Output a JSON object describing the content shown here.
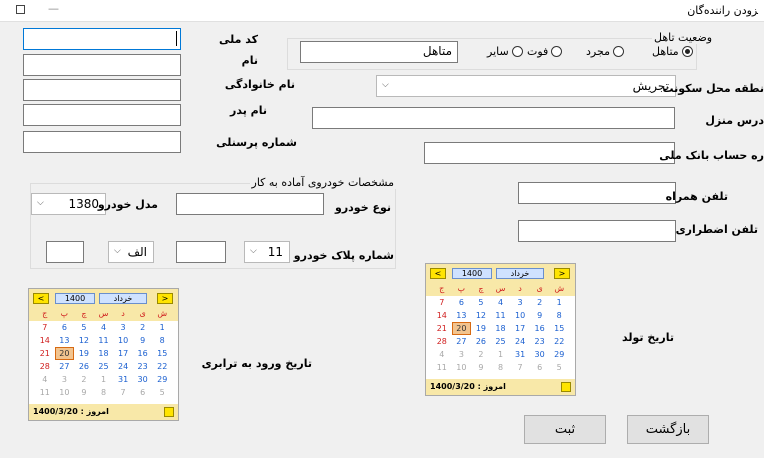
{
  "window": {
    "title": "ﺰودن راننده‌گان"
  },
  "right_form": {
    "marital": {
      "title": "وضعیت تاهل",
      "options": [
        "متاهل",
        "مجرد",
        "فوت",
        "سایر"
      ],
      "value": "متاهل"
    },
    "marital_text": "متاهل",
    "residence_region": {
      "label": "نطقه محل سکونت",
      "value": "تجریش"
    },
    "home_address": {
      "label": "درس منزل",
      "value": ""
    },
    "bank_account": {
      "label": "ره حساب بانک ملی",
      "value": ""
    },
    "mobile": {
      "label": "تلفن همراه",
      "value": ""
    },
    "emergency_phone": {
      "label": "تلفن اضطراری",
      "value": ""
    },
    "birth_date": {
      "label": "تاریخ تولد"
    }
  },
  "left_form": {
    "code_meli": {
      "label": "کد ملی",
      "value": ""
    },
    "first_name": {
      "label": "نام",
      "value": ""
    },
    "last_name": {
      "label": "نام خانوادگی",
      "value": ""
    },
    "father_name": {
      "label": "نام پدر",
      "value": ""
    },
    "personnel_no": {
      "label": "شماره پرسنلی",
      "value": ""
    }
  },
  "vehicle": {
    "title": "مشخصات خودروی آماده به کار",
    "car_type": {
      "label": "نوع خودرو",
      "value": ""
    },
    "car_model": {
      "label": "مدل خودرو",
      "value": "1380"
    },
    "plate": {
      "label": "شماره پلاک خودرو",
      "part1": "11",
      "letter": "الف",
      "part2": "",
      "part3": ""
    }
  },
  "entry_date": {
    "label": "تاریخ ورود به ترابری"
  },
  "calendar": {
    "month": "خرداد",
    "year": "1400",
    "prev": "<",
    "next": ">",
    "weekdays": [
      "ش",
      "ی",
      "د",
      "س",
      "چ",
      "پ",
      "ج"
    ],
    "days": [
      {
        "d": "1",
        "t": "n"
      },
      {
        "d": "2",
        "t": "n"
      },
      {
        "d": "3",
        "t": "n"
      },
      {
        "d": "4",
        "t": "n"
      },
      {
        "d": "5",
        "t": "n"
      },
      {
        "d": "6",
        "t": "n"
      },
      {
        "d": "7",
        "t": "f"
      },
      {
        "d": "8",
        "t": "n"
      },
      {
        "d": "9",
        "t": "n"
      },
      {
        "d": "10",
        "t": "n"
      },
      {
        "d": "11",
        "t": "n"
      },
      {
        "d": "12",
        "t": "n"
      },
      {
        "d": "13",
        "t": "n"
      },
      {
        "d": "14",
        "t": "f"
      },
      {
        "d": "15",
        "t": "n"
      },
      {
        "d": "16",
        "t": "n"
      },
      {
        "d": "17",
        "t": "n"
      },
      {
        "d": "18",
        "t": "n"
      },
      {
        "d": "19",
        "t": "n"
      },
      {
        "d": "20",
        "t": "s"
      },
      {
        "d": "21",
        "t": "f"
      },
      {
        "d": "22",
        "t": "n"
      },
      {
        "d": "23",
        "t": "n"
      },
      {
        "d": "24",
        "t": "n"
      },
      {
        "d": "25",
        "t": "n"
      },
      {
        "d": "26",
        "t": "n"
      },
      {
        "d": "27",
        "t": "n"
      },
      {
        "d": "28",
        "t": "f"
      },
      {
        "d": "29",
        "t": "n"
      },
      {
        "d": "30",
        "t": "n"
      },
      {
        "d": "31",
        "t": "n"
      },
      {
        "d": "1",
        "t": "o"
      },
      {
        "d": "2",
        "t": "o"
      },
      {
        "d": "3",
        "t": "o"
      },
      {
        "d": "4",
        "t": "o"
      },
      {
        "d": "5",
        "t": "o"
      },
      {
        "d": "6",
        "t": "o"
      },
      {
        "d": "7",
        "t": "o"
      },
      {
        "d": "8",
        "t": "o"
      },
      {
        "d": "9",
        "t": "o"
      },
      {
        "d": "10",
        "t": "o"
      },
      {
        "d": "11",
        "t": "o"
      }
    ],
    "today_text": "امروز : 1400/3/20"
  },
  "buttons": {
    "back": "بازگشت",
    "submit": "ثبت"
  }
}
